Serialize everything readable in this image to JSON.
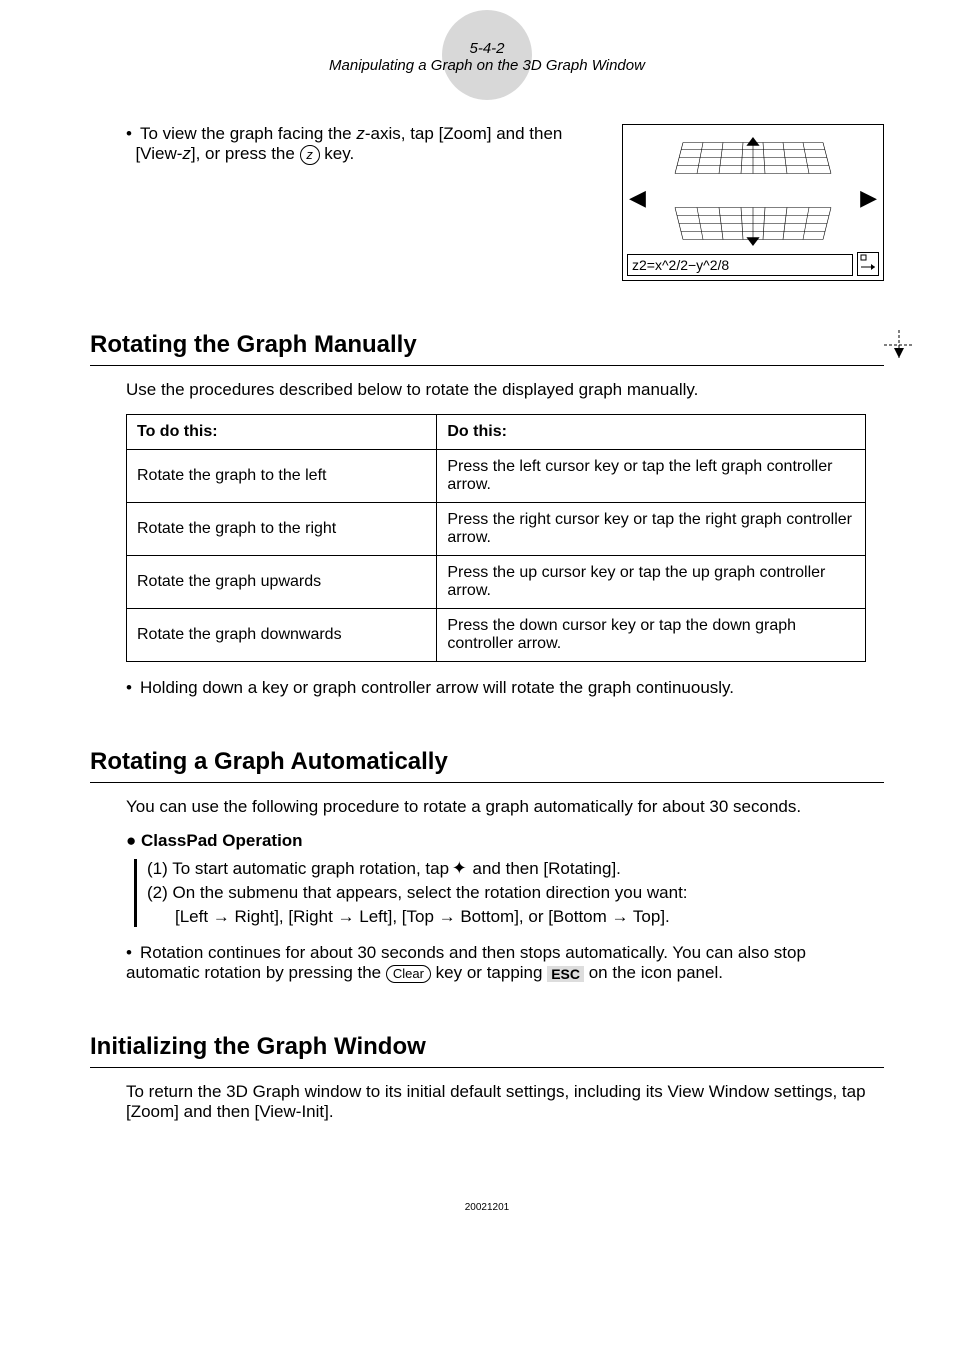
{
  "header": {
    "page_num": "5-4-2",
    "subtitle": "Manipulating a Graph on the 3D Graph Window"
  },
  "viewz": {
    "line1_pre": "To view the graph facing the ",
    "line1_var": "z",
    "line1_post": "-axis, tap [Zoom] and then",
    "line2_pre": "[View-",
    "line2_var": "z",
    "line2_post": "], or press the ",
    "line2_end": " key.",
    "key_label": "z",
    "fig_equation": "z2=x^2/2−y^2/8"
  },
  "sec1": {
    "title": "Rotating the Graph Manually",
    "intro": "Use the procedures described below to rotate the displayed graph manually.",
    "col1": "To do this:",
    "col2": "Do this:",
    "rows": [
      {
        "a": "Rotate the graph to the left",
        "b": "Press the left cursor key or tap the left graph controller arrow."
      },
      {
        "a": "Rotate the graph to the right",
        "b": "Press the right cursor key or tap the right graph controller arrow."
      },
      {
        "a": "Rotate the graph upwards",
        "b": "Press the up cursor key or tap the up graph controller arrow."
      },
      {
        "a": "Rotate the graph downwards",
        "b": "Press the down cursor key or tap the down graph controller arrow."
      }
    ],
    "note": "Holding down a key or graph controller arrow will rotate the graph continuously."
  },
  "sec2": {
    "title": "Rotating a Graph Automatically",
    "intro": "You can use the following procedure to rotate a graph automatically for about 30 seconds.",
    "subhead_bullet": "●",
    "subhead": "ClassPad Operation",
    "step1_pre": "(1) To start automatic graph rotation, tap ",
    "step1_post": " and then [Rotating].",
    "step2_a": "(2) On the submenu that appears, select the rotation direction you want:",
    "step2_b": "[Left → Right], [Right → Left], [Top → Bottom], or [Bottom → Top].",
    "note_pre": "Rotation continues for about 30 seconds and then stops automatically. You can also stop automatic rotation by pressing the ",
    "clear_label": "Clear",
    "note_mid": " key or tapping ",
    "esc_label": "ESC",
    "note_post": " on the icon panel."
  },
  "sec3": {
    "title": "Initializing the Graph Window",
    "body": "To return the 3D Graph window to its initial default settings, including its View Window settings, tap [Zoom] and then [View-Init]."
  },
  "footer": "20021201"
}
